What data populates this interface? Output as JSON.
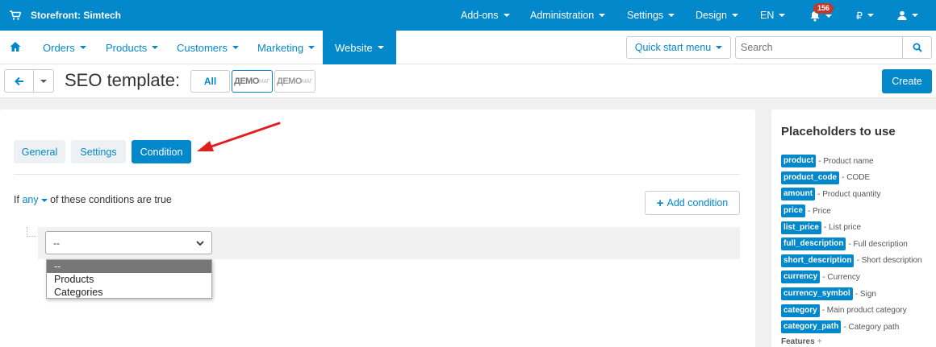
{
  "topbar": {
    "store_label": "Storefront: Simtech",
    "menu": [
      "Add-ons",
      "Administration",
      "Settings",
      "Design",
      "EN"
    ],
    "notifications_count": "156",
    "currency": "₽"
  },
  "subnav": {
    "items": [
      "Orders",
      "Products",
      "Customers",
      "Marketing",
      "Website"
    ],
    "quick_start": "Quick start menu",
    "search_placeholder": "Search"
  },
  "titlebar": {
    "title": "SEO template:",
    "all_label": "All",
    "logo_text": "ДЕМО",
    "logo_small": "МАГ",
    "create_label": "Create"
  },
  "main": {
    "tabs": [
      "General",
      "Settings",
      "Condition"
    ],
    "active_tab": "Condition",
    "condition_prefix": "If",
    "condition_any": "any",
    "condition_suffix": "of these conditions are true",
    "add_condition_label": "Add condition",
    "select_value": "--",
    "dropdown_options": [
      "--",
      "Products",
      "Categories"
    ]
  },
  "sidebar": {
    "title": "Placeholders to use",
    "placeholders": [
      {
        "tag": "product",
        "desc": "- Product name"
      },
      {
        "tag": "product_code",
        "desc": "- CODE"
      },
      {
        "tag": "amount",
        "desc": "- Product quantity"
      },
      {
        "tag": "price",
        "desc": "- Price"
      },
      {
        "tag": "list_price",
        "desc": "- List price"
      },
      {
        "tag": "full_description",
        "desc": "- Full description"
      },
      {
        "tag": "short_description",
        "desc": "- Short description"
      },
      {
        "tag": "currency",
        "desc": "- Currency"
      },
      {
        "tag": "currency_symbol",
        "desc": "- Sign"
      },
      {
        "tag": "category",
        "desc": "- Main product category"
      },
      {
        "tag": "category_path",
        "desc": "- Category path"
      }
    ],
    "features_label": "Features"
  },
  "colors": {
    "accent": "#0388cc",
    "arrow": "#e02020",
    "badge": "#c0392b"
  }
}
